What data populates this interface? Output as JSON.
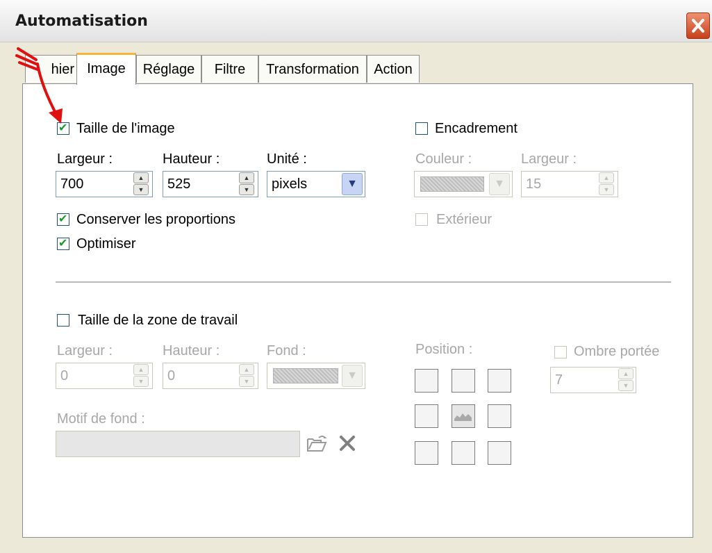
{
  "window": {
    "title": "Automatisation"
  },
  "tabs": [
    {
      "label": "Fichier",
      "visible_label": "hier"
    },
    {
      "label": "Image"
    },
    {
      "label": "Réglage"
    },
    {
      "label": "Filtre"
    },
    {
      "label": "Transformation"
    },
    {
      "label": "Action"
    }
  ],
  "image_size": {
    "label": "Taille de l'image",
    "checked": true,
    "width_label": "Largeur :",
    "width_value": "700",
    "height_label": "Hauteur :",
    "height_value": "525",
    "unit_label": "Unité :",
    "unit_value": "pixels",
    "keep_ratio_label": "Conserver les proportions",
    "keep_ratio_checked": true,
    "optimize_label": "Optimiser",
    "optimize_checked": true
  },
  "frame": {
    "label": "Encadrement",
    "checked": false,
    "color_label": "Couleur :",
    "width_label": "Largeur :",
    "width_value": "15",
    "outside_label": "Extérieur",
    "outside_checked": false
  },
  "canvas": {
    "label": "Taille de la zone de travail",
    "checked": false,
    "width_label": "Largeur :",
    "width_value": "0",
    "height_label": "Hauteur :",
    "height_value": "0",
    "background_label": "Fond :",
    "pattern_label": "Motif de fond :",
    "pattern_value": "",
    "position_label": "Position :",
    "shadow_label": "Ombre portée",
    "shadow_checked": false,
    "shadow_value": "7"
  },
  "icons": [
    "close-icon",
    "folder-open-icon",
    "delete-x-icon",
    "checkmark-icon",
    "spin-arrow-icon",
    "dropdown-arrow-icon"
  ],
  "colors": {
    "check": "#1a9a2c",
    "annotation_arrow": "#e01010",
    "active_tab": "#f6b739",
    "close_button": "#d4552e"
  }
}
